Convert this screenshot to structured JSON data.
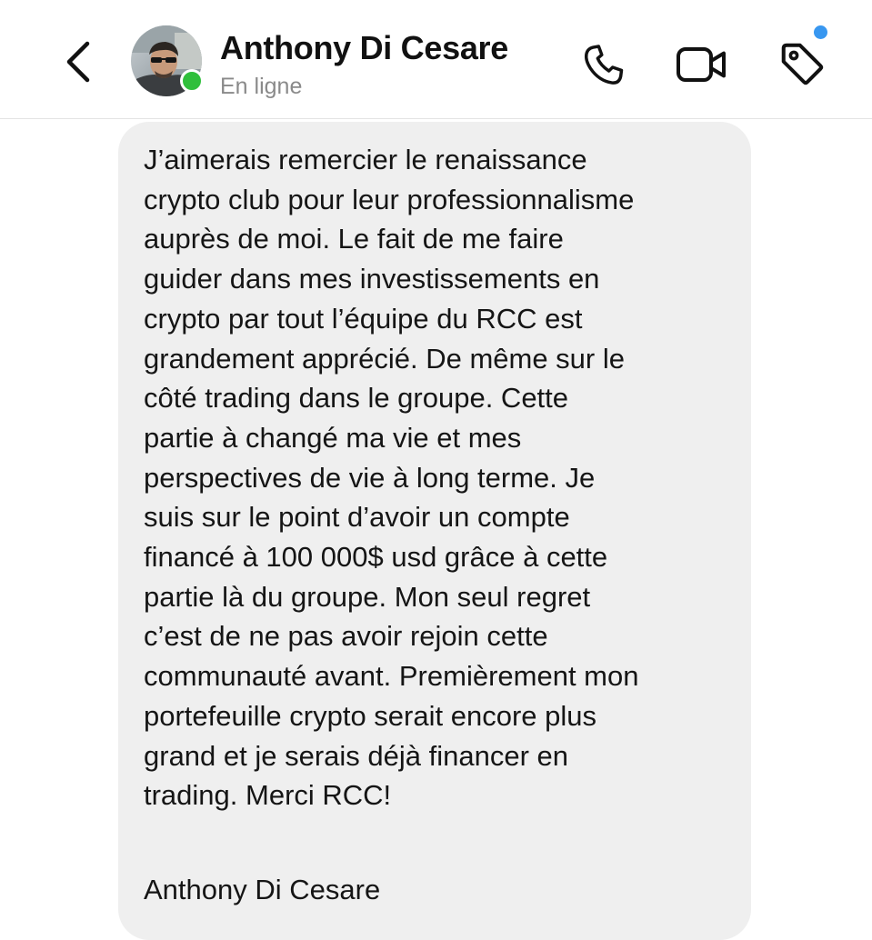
{
  "header": {
    "back_icon": "chevron-left-icon",
    "contact_name": "Anthony Di Cesare",
    "status": "En ligne",
    "online_color": "#2fbf3b",
    "icons": [
      "phone-icon",
      "video-camera-icon",
      "tag-icon"
    ],
    "tag_badge_color": "#3897f0"
  },
  "message": {
    "lines": [
      "J’aimerais remercier le renaissance",
      "crypto club pour leur professionnalisme",
      "auprès de moi. Le fait de me faire",
      "guider dans mes investissements en",
      "crypto par tout l’équipe du RCC est",
      "grandement apprécié. De même sur le",
      "côté trading dans le groupe. Cette",
      "partie à changé ma vie et mes",
      "perspectives de vie à long terme. Je",
      "suis sur le point d’avoir un compte",
      "financé à 100 000$ usd grâce à cette",
      "partie là du groupe. Mon seul regret",
      "c’est de ne pas avoir rejoin cette",
      "communauté avant. Premièrement mon",
      "portefeuille crypto serait encore plus",
      "grand et je serais déjà financer en",
      "trading. Merci RCC!"
    ],
    "signature": "Anthony Di Cesare",
    "bubble_color": "#efefef"
  }
}
